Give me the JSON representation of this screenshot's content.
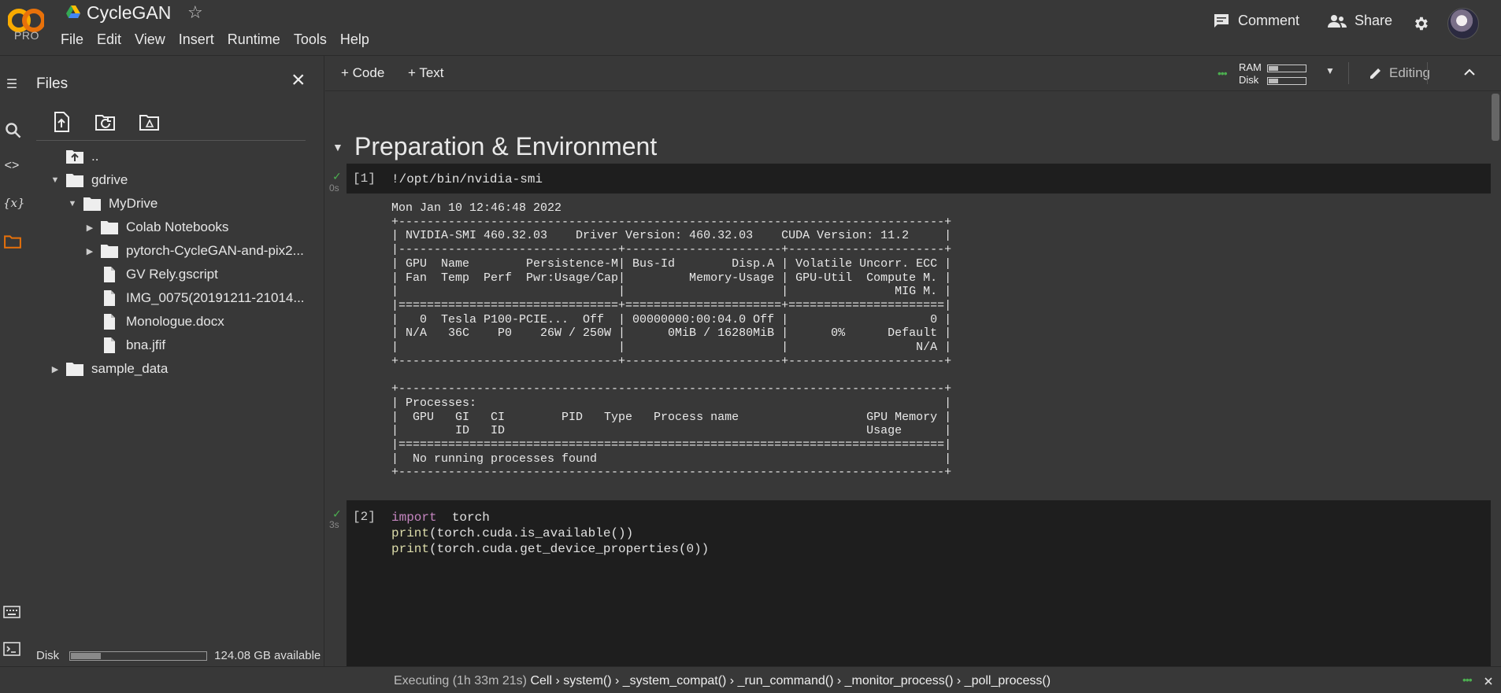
{
  "app": {
    "logo_text": "CO",
    "plan": "PRO",
    "title": "CycleGAN"
  },
  "menu": [
    "File",
    "Edit",
    "View",
    "Insert",
    "Runtime",
    "Tools",
    "Help"
  ],
  "header_actions": {
    "comment": "Comment",
    "share": "Share"
  },
  "files_panel": {
    "title": "Files",
    "tree": [
      {
        "label": "..",
        "icon": "folder-up-icon",
        "depth": 0,
        "twisty": "none"
      },
      {
        "label": "gdrive",
        "icon": "folder-icon",
        "depth": 0,
        "twisty": "open"
      },
      {
        "label": "MyDrive",
        "icon": "folder-icon",
        "depth": 1,
        "twisty": "open"
      },
      {
        "label": "Colab Notebooks",
        "icon": "folder-icon",
        "depth": 2,
        "twisty": "closed"
      },
      {
        "label": "pytorch-CycleGAN-and-pix2...",
        "icon": "folder-icon",
        "depth": 2,
        "twisty": "closed"
      },
      {
        "label": "GV Rely.gscript",
        "icon": "file-icon",
        "depth": 2,
        "twisty": "none"
      },
      {
        "label": "IMG_0075(20191211-21014...",
        "icon": "file-icon",
        "depth": 2,
        "twisty": "none"
      },
      {
        "label": "Monologue.docx",
        "icon": "file-icon",
        "depth": 2,
        "twisty": "none"
      },
      {
        "label": "bna.jfif",
        "icon": "file-icon",
        "depth": 2,
        "twisty": "none"
      },
      {
        "label": "sample_data",
        "icon": "folder-icon",
        "depth": 0,
        "twisty": "closed"
      }
    ],
    "disk_label": "Disk",
    "disk_available": "124.08 GB available",
    "disk_used_fraction": 0.22
  },
  "toolbar": {
    "add_code": "Code",
    "add_text": "Text",
    "ram_label": "RAM",
    "disk_label": "Disk",
    "ram_fraction": 0.25,
    "disk_fraction": 0.25,
    "mode": "Editing"
  },
  "notebook": {
    "section_title": "Preparation & Environment",
    "cell1": {
      "count": "[1]",
      "time": "0s",
      "code": "!/opt/bin/nvidia-smi",
      "output": "Mon Jan 10 12:46:48 2022\n+-----------------------------------------------------------------------------+\n| NVIDIA-SMI 460.32.03    Driver Version: 460.32.03    CUDA Version: 11.2     |\n|-------------------------------+----------------------+----------------------+\n| GPU  Name        Persistence-M| Bus-Id        Disp.A | Volatile Uncorr. ECC |\n| Fan  Temp  Perf  Pwr:Usage/Cap|         Memory-Usage | GPU-Util  Compute M. |\n|                               |                      |               MIG M. |\n|===============================+======================+======================|\n|   0  Tesla P100-PCIE...  Off  | 00000000:00:04.0 Off |                    0 |\n| N/A   36C    P0    26W / 250W |      0MiB / 16280MiB |      0%      Default |\n|                               |                      |                  N/A |\n+-------------------------------+----------------------+----------------------+\n\n+-----------------------------------------------------------------------------+\n| Processes:                                                                  |\n|  GPU   GI   CI        PID   Type   Process name                  GPU Memory |\n|        ID   ID                                                   Usage      |\n|=============================================================================|\n|  No running processes found                                                 |\n+-----------------------------------------------------------------------------+"
    },
    "cell2": {
      "count": "[2]",
      "time": "3s",
      "line1_kw": "import",
      "line1_rest": "  torch",
      "line2_fn": "print",
      "line2_rest": "(torch.cuda.is_available())",
      "line3_fn": "print",
      "line3_rest": "(torch.cuda.get_device_properties(0))"
    }
  },
  "status": {
    "executing": "Executing (1h 33m 21s)",
    "trace": [
      "Cell",
      "system()",
      "_system_compat()",
      "_run_command()",
      "_monitor_process()",
      "_poll_process()"
    ]
  }
}
